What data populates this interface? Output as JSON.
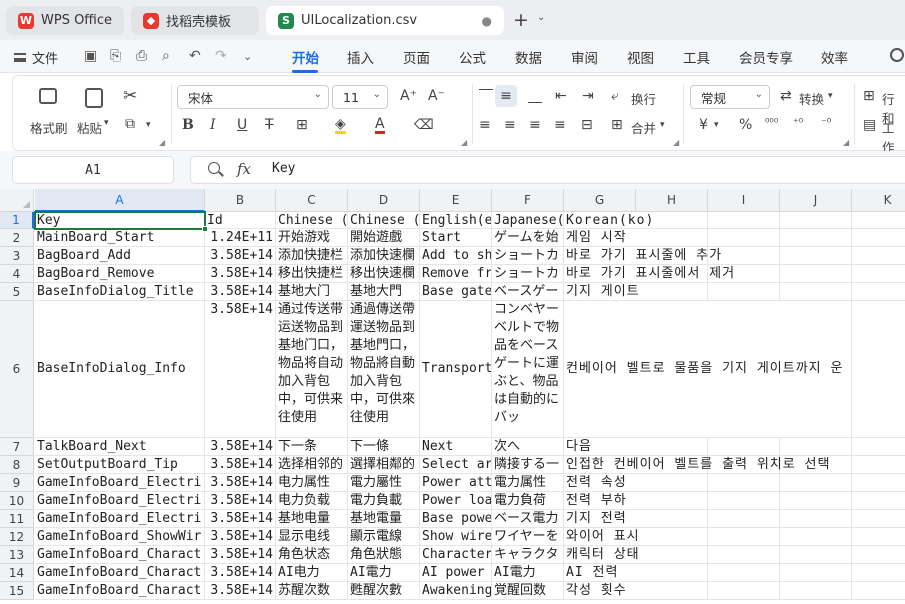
{
  "tabs": [
    {
      "label": "WPS Office",
      "icon": "wps-logo-icon",
      "color": "#e8382f"
    },
    {
      "label": "找稻壳模板",
      "icon": "docer-template-icon",
      "color": "#e8382f"
    },
    {
      "label": "UILocalization.csv",
      "icon": "spreadsheet-icon",
      "color": "#1f8a4c",
      "active": true
    }
  ],
  "menu": {
    "file_label": "文件",
    "items": [
      "开始",
      "插入",
      "页面",
      "公式",
      "数据",
      "审阅",
      "视图",
      "工具",
      "会员专享",
      "效率"
    ],
    "active": "开始"
  },
  "ribbon": {
    "format_painter": "格式刷",
    "paste": "粘贴",
    "font_name": "宋体",
    "font_size": "11",
    "wrap_text": "换行",
    "merge": "合并",
    "number_format": "常规",
    "convert": "转换",
    "row_col": "行和",
    "worksheet": "工作",
    "percent_sign": "%",
    "currency_sign": "¥"
  },
  "formula_bar": {
    "name_box": "A1",
    "fx_label": "fx",
    "value": "Key"
  },
  "columns": [
    "A",
    "B",
    "C",
    "D",
    "E",
    "F",
    "G",
    "H",
    "I",
    "J",
    "K"
  ],
  "selected_column": "A",
  "selected_row": "1",
  "rows": [
    {
      "n": "1",
      "A": "Key",
      "B": "Id",
      "C": "Chinese (",
      "D": "Chinese (",
      "E": "English(e",
      "F": "Japanese(",
      "G": "Korean(ko)"
    },
    {
      "n": "2",
      "A": "MainBoard_Start",
      "B": "1.24E+11",
      "C": "开始游戏",
      "D": "開始遊戲",
      "E": "Start",
      "F": "ゲームを始",
      "G": "게임 시작"
    },
    {
      "n": "3",
      "A": "BagBoard_Add",
      "B": "3.58E+14",
      "C": "添加快捷栏",
      "D": "添加快速欄",
      "E": "Add to sh",
      "F": "ショートカ",
      "G": "바로 가기 표시줄에 추가"
    },
    {
      "n": "4",
      "A": "BagBoard_Remove",
      "B": "3.58E+14",
      "C": "移出快捷栏",
      "D": "移出快速欄",
      "E": "Remove fr",
      "F": "ショートカ",
      "G": "바로 가기 표시줄에서 제거"
    },
    {
      "n": "5",
      "A": "BaseInfoDialog_Title",
      "B": "3.58E+14",
      "C": "基地大门",
      "D": "基地大門",
      "E": "Base gate",
      "F": "ベースゲー",
      "G": "기지 게이트"
    },
    {
      "n": "6",
      "A": "BaseInfoDialog_Info",
      "B": "3.58E+14",
      "C": "通过传送带运送物品到基地门口，物品将自动加入背包中，可供来往使用",
      "D": "通過傳送帶運送物品到基地門口，物品將自動加入背包中，可供來往使用",
      "E": "Transport",
      "F": "コンベヤーベルトで物品をベースゲートに運ぶと、物品は自動的にバッ",
      "G": "컨베이어 벨트로 물품을 기지 게이트까지 운"
    },
    {
      "n": "7",
      "A": "TalkBoard_Next",
      "B": "3.58E+14",
      "C": "下一条",
      "D": "下一條",
      "E": "Next",
      "F": "次へ",
      "G": "다음"
    },
    {
      "n": "8",
      "A": "SetOutputBoard_Tip",
      "B": "3.58E+14",
      "C": "选择相邻的",
      "D": "選擇相鄰的",
      "E": "Select ar",
      "F": "隣接する一",
      "G": "인접한 컨베이어 벨트를 출력 위치로 선택"
    },
    {
      "n": "9",
      "A": "GameInfoBoard_Electri",
      "B": "3.58E+14",
      "C": "电力属性",
      "D": "電力屬性",
      "E": "Power att",
      "F": "電力属性",
      "G": "전력 속성"
    },
    {
      "n": "10",
      "A": "GameInfoBoard_Electri",
      "B": "3.58E+14",
      "C": "电力负载",
      "D": "電力負載",
      "E": "Power loa",
      "F": "電力負荷",
      "G": "전력 부하"
    },
    {
      "n": "11",
      "A": "GameInfoBoard_Electri",
      "B": "3.58E+14",
      "C": "基地电量",
      "D": "基地電量",
      "E": "Base powe",
      "F": "ベース電力",
      "G": "기지 전력"
    },
    {
      "n": "12",
      "A": "GameInfoBoard_ShowWir",
      "B": "3.58E+14",
      "C": "显示电线",
      "D": "顯示電線",
      "E": "Show wire",
      "F": "ワイヤーを",
      "G": "와이어 표시"
    },
    {
      "n": "13",
      "A": "GameInfoBoard_Charact",
      "B": "3.58E+14",
      "C": "角色状态",
      "D": "角色狀態",
      "E": "Character",
      "F": "キャラクタ",
      "G": "캐릭터 상태"
    },
    {
      "n": "14",
      "A": "GameInfoBoard_Charact",
      "B": "3.58E+14",
      "C": "AI电力",
      "D": "AI電力",
      "E": "AI power",
      "F": "AI電力",
      "G": "AI 전력"
    },
    {
      "n": "15",
      "A": "GameInfoBoard_Charact",
      "B": "3.58E+14",
      "C": "苏醒次数",
      "D": "甦醒次數",
      "E": "Awakening",
      "F": "覚醒回数",
      "G": "각성 횟수"
    }
  ]
}
